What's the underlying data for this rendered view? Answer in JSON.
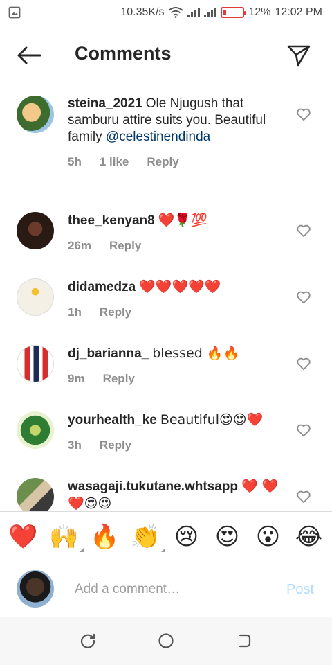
{
  "status": {
    "network_speed": "10.35K/s",
    "battery_percent": "12%",
    "battery_level": 0.12,
    "time": "12:02 PM",
    "icons": [
      "gallery-icon",
      "wifi-icon",
      "signal-icon",
      "signal-icon",
      "battery-icon"
    ]
  },
  "header": {
    "title": "Comments",
    "back_icon": "arrow-left-icon",
    "share_icon": "send-icon"
  },
  "comments": [
    {
      "username": "steina_2021",
      "text": "Ole Njugush that samburu attire suits you. Beautiful family",
      "mention": "@celestinendinda",
      "time": "5h",
      "likes": "1 like",
      "reply": "Reply"
    },
    {
      "username": "thee_kenyan8",
      "text": "❤️🌹💯",
      "time": "26m",
      "reply": "Reply"
    },
    {
      "username": "didamedza",
      "text": "❤️❤️❤️❤️❤️",
      "time": "1h",
      "reply": "Reply"
    },
    {
      "username": "dj_barianna_",
      "text": "blessed 🔥🔥",
      "time": "9m",
      "reply": "Reply"
    },
    {
      "username": "yourhealth_ke",
      "text": "Beautiful😍😍❤️",
      "time": "3h",
      "reply": "Reply"
    },
    {
      "username": "wasagaji.tukutane.whtsapp",
      "text": "❤️ ❤️❤️😍😍",
      "time": "",
      "reply": ""
    }
  ],
  "emoji_bar": [
    "❤️",
    "🙌",
    "🔥",
    "👏",
    "😢",
    "😍",
    "😮",
    "😂"
  ],
  "composer": {
    "placeholder": "Add a comment…",
    "post_label": "Post"
  },
  "nav": {
    "icons": [
      "recent-apps-icon",
      "home-icon",
      "back-icon"
    ]
  },
  "colors": {
    "mention": "#00376b",
    "post_disabled": "#b3dbff",
    "meta_grey": "#8e8e8e",
    "heart_red": "#ed1c24"
  }
}
